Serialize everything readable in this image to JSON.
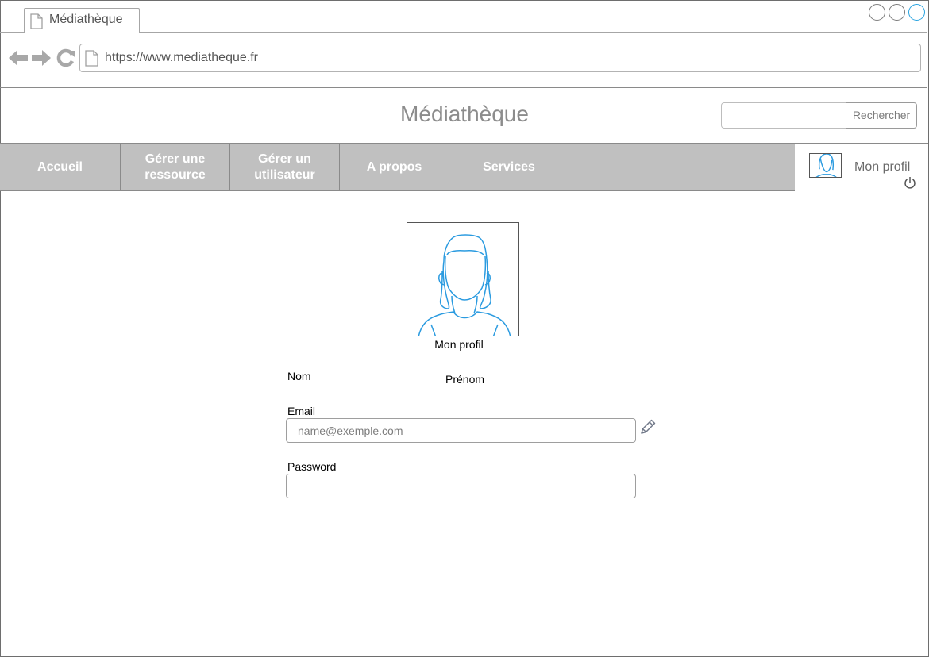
{
  "browser": {
    "tab_title": "Médiathèque",
    "url": "https://www.mediatheque.fr"
  },
  "header": {
    "site_title": "Médiathèque",
    "search_placeholder": "",
    "search_button": "Rechercher"
  },
  "nav": {
    "items": [
      {
        "label": "Accueil"
      },
      {
        "label": "Gérer une ressource"
      },
      {
        "label": "Gérer un utilisateur"
      },
      {
        "label": "A propos"
      },
      {
        "label": "Services"
      }
    ],
    "profile_label": "Mon profil"
  },
  "profile": {
    "caption": "Mon profil",
    "nom_label": "Nom",
    "prenom_label": "Prénom",
    "email_label": "Email",
    "email_placeholder": "name@exemple.com",
    "password_label": "Password"
  },
  "colors": {
    "nav_bg": "#c0c0c0",
    "avatar_line": "#2b9be0",
    "window_button_active": "#29a3e0"
  }
}
